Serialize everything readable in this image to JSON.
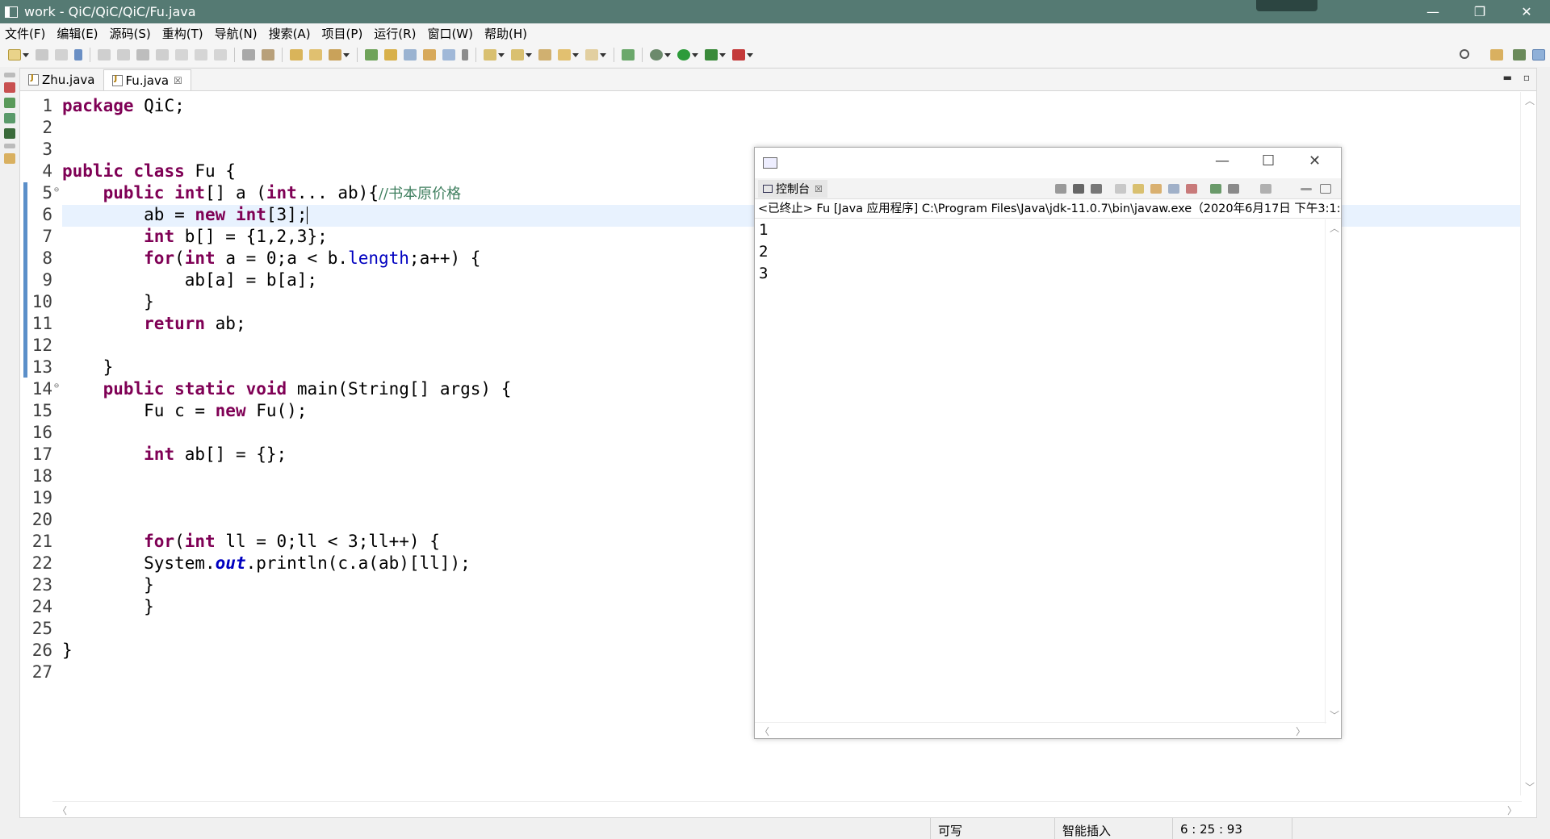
{
  "window": {
    "title": "work - QiC/QiC/QiC/Fu.java",
    "minimize": "—",
    "restore": "❐",
    "close": "✕"
  },
  "menu": [
    "文件(F)",
    "编辑(E)",
    "源码(S)",
    "重构(T)",
    "导航(N)",
    "搜索(A)",
    "项目(P)",
    "运行(R)",
    "窗口(W)",
    "帮助(H)"
  ],
  "tabs": [
    {
      "label": "Zhu.java",
      "active": false
    },
    {
      "label": "Fu.java",
      "active": true,
      "close": "☒"
    }
  ],
  "editor": {
    "line_numbers": [
      "1",
      "2",
      "3",
      "4",
      "5",
      "6",
      "7",
      "8",
      "9",
      "10",
      "11",
      "12",
      "13",
      "14",
      "15",
      "16",
      "17",
      "18",
      "19",
      "20",
      "21",
      "22",
      "23",
      "24",
      "25",
      "26",
      "27"
    ],
    "fold_markers": {
      "5": "⊖",
      "14": "⊖"
    },
    "lines": [
      {
        "n": 1,
        "segs": [
          {
            "t": "package",
            "c": "kw"
          },
          {
            "t": " QiC;"
          }
        ]
      },
      {
        "n": 2,
        "segs": []
      },
      {
        "n": 3,
        "segs": []
      },
      {
        "n": 4,
        "segs": [
          {
            "t": "public",
            "c": "kw"
          },
          {
            "t": " "
          },
          {
            "t": "class",
            "c": "kw"
          },
          {
            "t": " Fu {"
          }
        ]
      },
      {
        "n": 5,
        "segs": [
          {
            "t": "    "
          },
          {
            "t": "public",
            "c": "kw"
          },
          {
            "t": " "
          },
          {
            "t": "int",
            "c": "kw"
          },
          {
            "t": "[] a ("
          },
          {
            "t": "int",
            "c": "kw"
          },
          {
            "t": "... ab){"
          },
          {
            "t": "//书本原价格",
            "c": "cm"
          }
        ]
      },
      {
        "n": 6,
        "segs": [
          {
            "t": "        ab = "
          },
          {
            "t": "new",
            "c": "kw"
          },
          {
            "t": " "
          },
          {
            "t": "int",
            "c": "kw"
          },
          {
            "t": "[3];"
          },
          {
            "t": "",
            "c": "caret"
          }
        ]
      },
      {
        "n": 7,
        "segs": [
          {
            "t": "        "
          },
          {
            "t": "int",
            "c": "kw"
          },
          {
            "t": " b[] = {1,2,3};"
          }
        ]
      },
      {
        "n": 8,
        "segs": [
          {
            "t": "        "
          },
          {
            "t": "for",
            "c": "kw"
          },
          {
            "t": "("
          },
          {
            "t": "int",
            "c": "kw"
          },
          {
            "t": " a = 0;a < b."
          },
          {
            "t": "length",
            "c": "fld"
          },
          {
            "t": ";a++) {"
          }
        ]
      },
      {
        "n": 9,
        "segs": [
          {
            "t": "            ab[a] = b[a];"
          }
        ]
      },
      {
        "n": 10,
        "segs": [
          {
            "t": "        }"
          }
        ]
      },
      {
        "n": 11,
        "segs": [
          {
            "t": "        "
          },
          {
            "t": "return",
            "c": "kw"
          },
          {
            "t": " ab;"
          }
        ]
      },
      {
        "n": 12,
        "segs": []
      },
      {
        "n": 13,
        "segs": [
          {
            "t": "    }"
          }
        ]
      },
      {
        "n": 14,
        "segs": [
          {
            "t": "    "
          },
          {
            "t": "public",
            "c": "kw"
          },
          {
            "t": " "
          },
          {
            "t": "static",
            "c": "kw"
          },
          {
            "t": " "
          },
          {
            "t": "void",
            "c": "kw"
          },
          {
            "t": " main(String[] args) {"
          }
        ]
      },
      {
        "n": 15,
        "segs": [
          {
            "t": "        Fu c = "
          },
          {
            "t": "new",
            "c": "kw"
          },
          {
            "t": " Fu();"
          }
        ]
      },
      {
        "n": 16,
        "segs": []
      },
      {
        "n": 17,
        "segs": [
          {
            "t": "        "
          },
          {
            "t": "int",
            "c": "kw"
          },
          {
            "t": " ab[] = {};"
          }
        ]
      },
      {
        "n": 18,
        "segs": []
      },
      {
        "n": 19,
        "segs": []
      },
      {
        "n": 20,
        "segs": []
      },
      {
        "n": 21,
        "segs": [
          {
            "t": "        "
          },
          {
            "t": "for",
            "c": "kw"
          },
          {
            "t": "("
          },
          {
            "t": "int",
            "c": "kw"
          },
          {
            "t": " ll = 0;ll < 3;ll++) {"
          }
        ]
      },
      {
        "n": 22,
        "segs": [
          {
            "t": "        System."
          },
          {
            "t": "out",
            "c": "sfld"
          },
          {
            "t": ".println(c.a(ab)[ll]);"
          }
        ]
      },
      {
        "n": 23,
        "segs": [
          {
            "t": "        }"
          }
        ]
      },
      {
        "n": 24,
        "segs": [
          {
            "t": "        }"
          }
        ]
      },
      {
        "n": 25,
        "segs": []
      },
      {
        "n": 26,
        "segs": [
          {
            "t": "}"
          }
        ]
      },
      {
        "n": 27,
        "segs": []
      }
    ]
  },
  "console": {
    "tab_label": "控制台",
    "tab_close": "☒",
    "info": "<已终止> Fu [Java 应用程序] C:\\Program Files\\Java\\jdk-11.0.7\\bin\\javaw.exe（2020年6月17日 下午3:1:",
    "output": [
      "1",
      "2",
      "3"
    ],
    "minimize": "—",
    "maximize": "☐",
    "close": "✕"
  },
  "status": {
    "writable": "可写",
    "insert_mode": "智能插入",
    "position": "6 : 25 : 93"
  },
  "colors": {
    "titlebar": "#557a73",
    "keyword": "#7f0055",
    "comment": "#3f7f5f",
    "field": "#0000c0",
    "current_line": "#e8f2fe",
    "change_bar": "#5b8fc9"
  }
}
